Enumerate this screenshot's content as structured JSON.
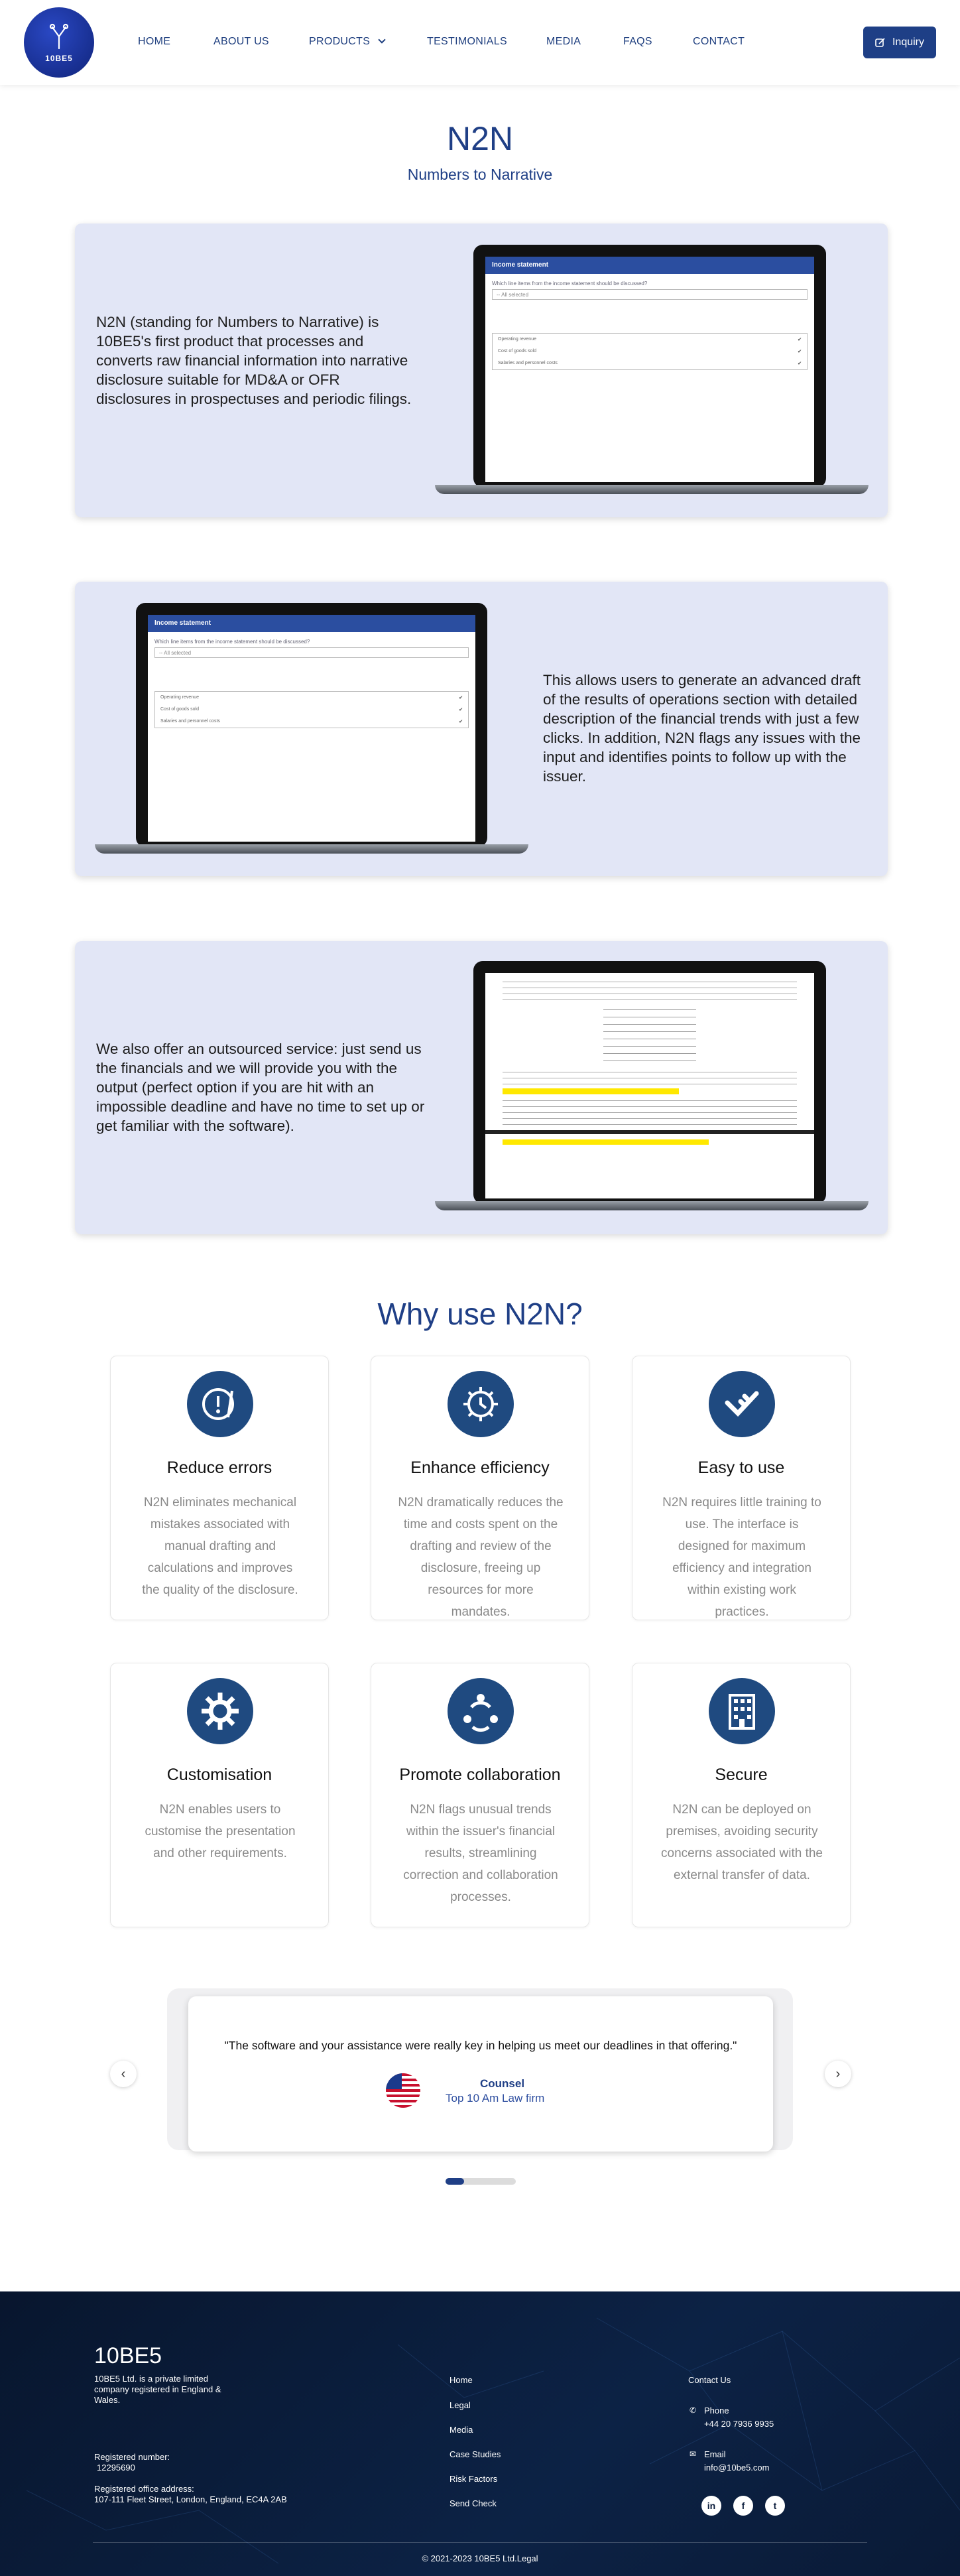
{
  "nav": {
    "logo_text": "10BE5",
    "items": [
      "HOME",
      "ABOUT US",
      "PRODUCTS",
      "TESTIMONIALS",
      "MEDIA",
      "FAQS",
      "CONTACT"
    ],
    "inquiry_label": "Inquiry"
  },
  "hero": {
    "title": "N2N",
    "subtitle": "Numbers to Narrative"
  },
  "panels": [
    {
      "text": "N2N (standing for Numbers to Narrative) is 10BE5's first product that processes and converts raw financial information into narrative disclosure suitable for MD&A or OFR disclosures in prospectuses and periodic filings."
    },
    {
      "text": "This allows users to generate an advanced draft of the results of operations section with detailed description of the financial trends with just a few clicks. In addition, N2N flags any issues with the input and identifies points to follow up with the issuer."
    },
    {
      "text": "We also offer an outsourced service: just send us the financials and we will provide you with the output (perfect option if you are hit with an impossible deadline and have no time to set up or get familiar with the software)."
    }
  ],
  "mockup": {
    "bar_title": "Income statement",
    "question": "Which line items from the income statement should be discussed?",
    "dropdown": "-- All selected",
    "options": [
      "Operating revenue",
      "Cost of goods sold",
      "Salaries and personnel costs"
    ]
  },
  "why": {
    "title": "Why use N2N?",
    "cards": [
      {
        "icon": "alert-icon",
        "title": "Reduce errors",
        "desc": "N2N eliminates mechanical mistakes associated with manual drafting and calculations and improves the quality of the disclosure."
      },
      {
        "icon": "gear-clock-icon",
        "title": "Enhance efficiency",
        "desc": "N2N dramatically reduces the time and costs spent on the drafting and review of the disclosure, freeing up resources for more mandates."
      },
      {
        "icon": "check-icon",
        "title": "Easy to use",
        "desc": "N2N requires little training to use. The interface is designed for maximum efficiency and integration within existing work practices."
      },
      {
        "icon": "cog-icon",
        "title": "Customisation",
        "desc": "N2N enables users to customise the presentation and other requirements."
      },
      {
        "icon": "collaboration-icon",
        "title": "Promote collaboration",
        "desc": "N2N flags unusual trends within the issuer's financial results, streamlining correction and collaboration processes."
      },
      {
        "icon": "building-icon",
        "title": "Secure",
        "desc": "N2N can be deployed on premises, avoiding security concerns associated with the external transfer of data."
      }
    ]
  },
  "testimonial": {
    "quote": "\"The software and your assistance were really key in helping us meet our deadlines in that offering.\"",
    "name": "Counsel",
    "org": "Top 10 Am Law firm"
  },
  "footer": {
    "brand": "10BE5",
    "blurb": "10BE5 Ltd. is a private limited company registered in England & Wales.",
    "reg_label": "Registered number:",
    "reg_number": "12295690",
    "office_label": "Registered office address:",
    "office": "107-111 Fleet Street, London, England, EC4A 2AB",
    "links": [
      "Home",
      "Legal",
      "Media",
      "Case Studies",
      "Risk Factors",
      "Send Check"
    ],
    "contact_title": "Contact Us",
    "phone_label": "Phone",
    "phone": "+44 20 7936 9935",
    "email_label": "Email",
    "email": "info@10be5.com",
    "copyright": "© 2021-2023 10BE5 Ltd.Legal"
  }
}
